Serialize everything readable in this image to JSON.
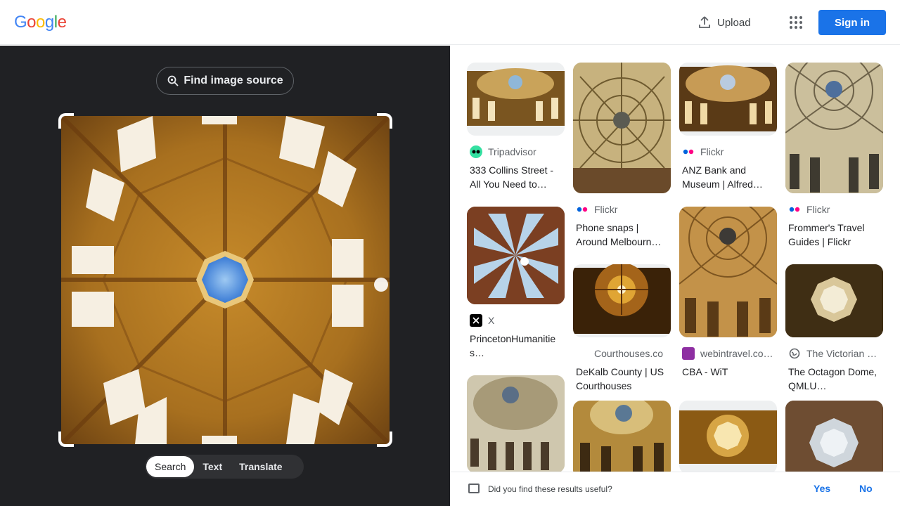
{
  "header": {
    "logo_letters": [
      "G",
      "o",
      "o",
      "g",
      "l",
      "e"
    ],
    "logo_colors": [
      "#4285f4",
      "#ea4335",
      "#fbbc05",
      "#4285f4",
      "#34a853",
      "#ea4335"
    ],
    "upload_label": "Upload",
    "apps_icon": "apps-grid-icon",
    "sign_in_label": "Sign in",
    "accent_color": "#1a73e8"
  },
  "lens": {
    "find_source_label": "Find image source",
    "modes": [
      "Search",
      "Text",
      "Translate"
    ],
    "active_mode": "Search"
  },
  "results": {
    "columns": [
      [
        {
          "source": "Tripadvisor",
          "favicon": "tripadvisor-icon",
          "title": "333 Collins Street - All You Need to…"
        },
        {
          "source": "X",
          "favicon": "x-icon",
          "title": "PrincetonHumanities…"
        },
        {
          "source": "",
          "favicon": "",
          "title": ""
        }
      ],
      [
        {
          "source": "Flickr",
          "favicon": "flickr-icon",
          "title": "Phone snaps | Around Melbourn…"
        },
        {
          "source": "Courthouses.co",
          "favicon": "",
          "title": "DeKalb County | US Courthouses"
        },
        {
          "source": "",
          "favicon": "",
          "title": ""
        }
      ],
      [
        {
          "source": "Flickr",
          "favicon": "flickr-icon",
          "title": "ANZ Bank and Museum | Alfred…"
        },
        {
          "source": "webintravel.co…",
          "favicon": "webintravel-icon",
          "title": "CBA - WiT"
        },
        {
          "source": "",
          "favicon": "",
          "title": ""
        }
      ],
      [
        {
          "source": "Flickr",
          "favicon": "flickr-icon",
          "title": "Frommer's Travel Guides | Flickr"
        },
        {
          "source": "The Victorian …",
          "favicon": "globe-icon",
          "title": "The Octagon Dome, QMLU…"
        },
        {
          "source": "",
          "favicon": "",
          "title": ""
        }
      ]
    ]
  },
  "feedback": {
    "question": "Did you find these results useful?",
    "yes_label": "Yes",
    "no_label": "No"
  }
}
